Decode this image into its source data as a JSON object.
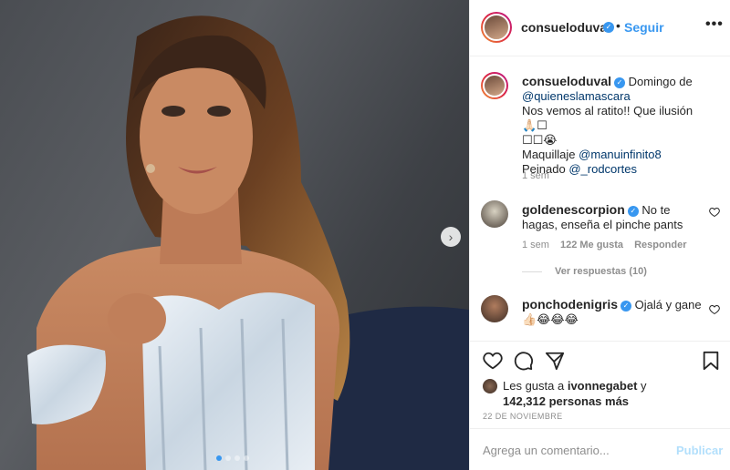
{
  "post": {
    "username": "consueloduval",
    "follow_label": "Seguir",
    "separator": "•",
    "more_label": "•••",
    "next_arrow": "›",
    "carousel": {
      "count": 4,
      "active": 0
    }
  },
  "caption": {
    "username": "consueloduval",
    "line1": "Domingo de",
    "mention1": "@quieneslamascara",
    "line2": "Nos vemos al ratito!! Que ilusión🙏🏻☐",
    "line3": "☐☐😭",
    "makeup_label": "Maquillaje",
    "mention2": "@manuinfinito8",
    "hair_label": "Peinado",
    "mention3": "@_rodcortes",
    "time": "1 sem"
  },
  "comments": [
    {
      "username": "goldenescorpion",
      "text": "No te hagas, enseña el pinche pants",
      "time": "1 sem",
      "likes": "122 Me gusta",
      "reply_label": "Responder",
      "replies_label": "Ver respuestas (10)"
    },
    {
      "username": "ponchodenigris",
      "text": "Ojalá y gane",
      "emoji": "👍🏻😂😂😂"
    }
  ],
  "likes": {
    "prefix": "Les gusta a",
    "user": "ivonnegabet",
    "conj": "y",
    "count": "142,312 personas más"
  },
  "date": "22 DE NOVIEMBRE",
  "composer": {
    "placeholder": "Agrega un comentario...",
    "publish_label": "Publicar"
  },
  "icons": {
    "like": "heart-icon",
    "comment": "comment-icon",
    "share": "share-icon",
    "save": "bookmark-icon",
    "verified": "verified-badge-icon"
  },
  "colors": {
    "accent": "#3897f0",
    "mention": "#00376b",
    "muted": "#8e8e8e",
    "publish_disabled": "#b2dffc"
  }
}
